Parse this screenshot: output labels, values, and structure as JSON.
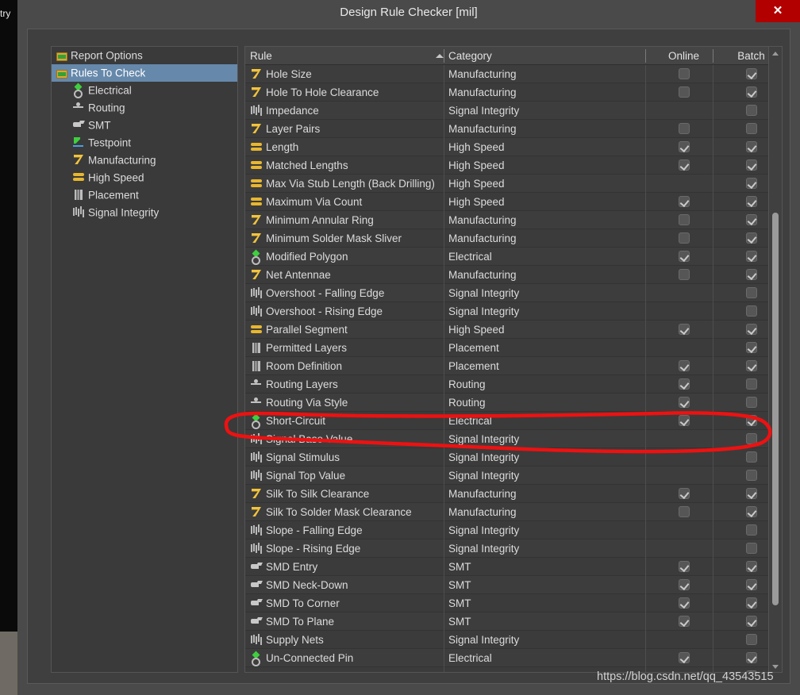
{
  "window": {
    "title": "Design Rule Checker [mil]",
    "close_label": "✕",
    "desktop_label": "try"
  },
  "sidebar": {
    "items": [
      {
        "label": "Report Options",
        "icon": "folder-icon",
        "indent": 0,
        "selected": false
      },
      {
        "label": "Rules To Check",
        "icon": "folder-icon",
        "indent": 0,
        "selected": true
      },
      {
        "label": "Electrical",
        "icon": "electrical-icon",
        "indent": 1,
        "selected": false
      },
      {
        "label": "Routing",
        "icon": "routing-icon",
        "indent": 1,
        "selected": false
      },
      {
        "label": "SMT",
        "icon": "smt-icon",
        "indent": 1,
        "selected": false
      },
      {
        "label": "Testpoint",
        "icon": "testpoint-icon",
        "indent": 1,
        "selected": false
      },
      {
        "label": "Manufacturing",
        "icon": "manufacturing-icon",
        "indent": 1,
        "selected": false
      },
      {
        "label": "High Speed",
        "icon": "high-speed-icon",
        "indent": 1,
        "selected": false
      },
      {
        "label": "Placement",
        "icon": "placement-icon",
        "indent": 1,
        "selected": false
      },
      {
        "label": "Signal Integrity",
        "icon": "signal-integrity-icon",
        "indent": 1,
        "selected": false
      }
    ]
  },
  "table": {
    "columns": [
      "Rule",
      "Category",
      "Online",
      "Batch"
    ],
    "sort_column": "Rule",
    "sort_direction": "ascending",
    "rows": [
      {
        "rule": "Hole Size",
        "category": "Manufacturing",
        "icon": "manufacturing-icon",
        "online": "unchecked",
        "batch": "checked"
      },
      {
        "rule": "Hole To Hole Clearance",
        "category": "Manufacturing",
        "icon": "manufacturing-icon",
        "online": "unchecked",
        "batch": "checked"
      },
      {
        "rule": "Impedance",
        "category": "Signal Integrity",
        "icon": "signal-integrity-icon",
        "online": "none",
        "batch": "unchecked"
      },
      {
        "rule": "Layer Pairs",
        "category": "Manufacturing",
        "icon": "manufacturing-icon",
        "online": "unchecked",
        "batch": "unchecked"
      },
      {
        "rule": "Length",
        "category": "High Speed",
        "icon": "high-speed-icon",
        "online": "checked",
        "batch": "checked"
      },
      {
        "rule": "Matched Lengths",
        "category": "High Speed",
        "icon": "high-speed-icon",
        "online": "checked",
        "batch": "checked"
      },
      {
        "rule": "Max Via Stub Length (Back Drilling)",
        "category": "High Speed",
        "icon": "high-speed-icon",
        "online": "none",
        "batch": "checked"
      },
      {
        "rule": "Maximum Via Count",
        "category": "High Speed",
        "icon": "high-speed-icon",
        "online": "checked",
        "batch": "checked"
      },
      {
        "rule": "Minimum Annular Ring",
        "category": "Manufacturing",
        "icon": "manufacturing-icon",
        "online": "unchecked",
        "batch": "checked"
      },
      {
        "rule": "Minimum Solder Mask Sliver",
        "category": "Manufacturing",
        "icon": "manufacturing-icon",
        "online": "unchecked",
        "batch": "checked"
      },
      {
        "rule": "Modified Polygon",
        "category": "Electrical",
        "icon": "electrical-icon",
        "online": "checked",
        "batch": "checked"
      },
      {
        "rule": "Net Antennae",
        "category": "Manufacturing",
        "icon": "manufacturing-icon",
        "online": "unchecked",
        "batch": "checked"
      },
      {
        "rule": "Overshoot - Falling Edge",
        "category": "Signal Integrity",
        "icon": "signal-integrity-icon",
        "online": "none",
        "batch": "unchecked"
      },
      {
        "rule": "Overshoot - Rising Edge",
        "category": "Signal Integrity",
        "icon": "signal-integrity-icon",
        "online": "none",
        "batch": "unchecked"
      },
      {
        "rule": "Parallel Segment",
        "category": "High Speed",
        "icon": "high-speed-icon",
        "online": "checked",
        "batch": "checked"
      },
      {
        "rule": "Permitted Layers",
        "category": "Placement",
        "icon": "placement-icon",
        "online": "none",
        "batch": "checked"
      },
      {
        "rule": "Room Definition",
        "category": "Placement",
        "icon": "placement-icon",
        "online": "checked",
        "batch": "checked"
      },
      {
        "rule": "Routing Layers",
        "category": "Routing",
        "icon": "routing-icon",
        "online": "checked",
        "batch": "unchecked"
      },
      {
        "rule": "Routing Via Style",
        "category": "Routing",
        "icon": "routing-icon",
        "online": "checked",
        "batch": "unchecked"
      },
      {
        "rule": "Short-Circuit",
        "category": "Electrical",
        "icon": "electrical-icon",
        "online": "checked",
        "batch": "checked"
      },
      {
        "rule": "Signal Base Value",
        "category": "Signal Integrity",
        "icon": "signal-integrity-icon",
        "online": "none",
        "batch": "unchecked"
      },
      {
        "rule": "Signal Stimulus",
        "category": "Signal Integrity",
        "icon": "signal-integrity-icon",
        "online": "none",
        "batch": "unchecked"
      },
      {
        "rule": "Signal Top Value",
        "category": "Signal Integrity",
        "icon": "signal-integrity-icon",
        "online": "none",
        "batch": "unchecked"
      },
      {
        "rule": "Silk To Silk Clearance",
        "category": "Manufacturing",
        "icon": "manufacturing-icon",
        "online": "checked",
        "batch": "checked"
      },
      {
        "rule": "Silk To Solder Mask Clearance",
        "category": "Manufacturing",
        "icon": "manufacturing-icon",
        "online": "unchecked",
        "batch": "checked"
      },
      {
        "rule": "Slope - Falling Edge",
        "category": "Signal Integrity",
        "icon": "signal-integrity-icon",
        "online": "none",
        "batch": "unchecked"
      },
      {
        "rule": "Slope - Rising Edge",
        "category": "Signal Integrity",
        "icon": "signal-integrity-icon",
        "online": "none",
        "batch": "unchecked"
      },
      {
        "rule": "SMD Entry",
        "category": "SMT",
        "icon": "smt-icon",
        "online": "checked",
        "batch": "checked"
      },
      {
        "rule": "SMD Neck-Down",
        "category": "SMT",
        "icon": "smt-icon",
        "online": "checked",
        "batch": "checked"
      },
      {
        "rule": "SMD To Corner",
        "category": "SMT",
        "icon": "smt-icon",
        "online": "checked",
        "batch": "checked"
      },
      {
        "rule": "SMD To Plane",
        "category": "SMT",
        "icon": "smt-icon",
        "online": "checked",
        "batch": "checked"
      },
      {
        "rule": "Supply Nets",
        "category": "Signal Integrity",
        "icon": "signal-integrity-icon",
        "online": "none",
        "batch": "unchecked"
      },
      {
        "rule": "Un-Connected Pin",
        "category": "Electrical",
        "icon": "electrical-icon",
        "online": "checked",
        "batch": "checked"
      },
      {
        "rule": "",
        "category": "",
        "icon": "smt-icon",
        "online": "none",
        "batch": "unchecked"
      }
    ]
  },
  "annotation": {
    "type": "hand-drawn-ellipse",
    "target_row": "Short-Circuit",
    "color": "#ee1111"
  },
  "watermark": {
    "text": "https://blog.csdn.net/qq_43543515"
  },
  "colors": {
    "accent_selection": "#6688aa",
    "close_button": "#b20000",
    "dialog_bg": "#4a4a4a",
    "panel_bg": "#3b3b3b",
    "annotation_red": "#ee1111"
  }
}
